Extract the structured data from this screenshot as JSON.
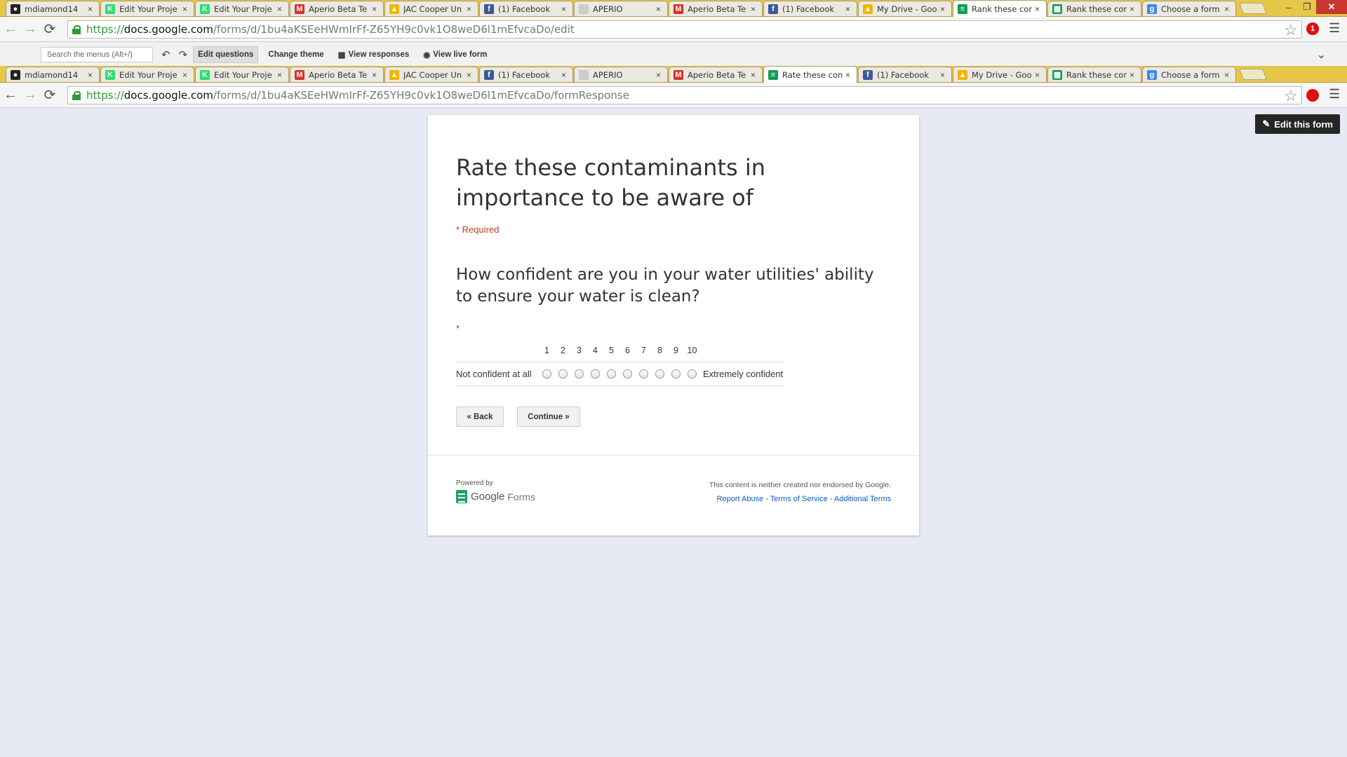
{
  "window": {
    "minimize": "–",
    "restore": "❐",
    "close": "✕"
  },
  "tabs_top": [
    {
      "title": "mdiamond14",
      "icon": "github-icon",
      "color": "#222222",
      "glyph": "●"
    },
    {
      "title": "Edit Your Proje",
      "icon": "kickstarter-icon",
      "color": "#2bde73",
      "glyph": "K"
    },
    {
      "title": "Edit Your Proje",
      "icon": "kickstarter-icon",
      "color": "#2bde73",
      "glyph": "K"
    },
    {
      "title": "Aperio Beta Te",
      "icon": "gmail-icon",
      "color": "#d93025",
      "glyph": "M"
    },
    {
      "title": "JAC Cooper Un",
      "icon": "drive-icon",
      "color": "#f4b400",
      "glyph": "▲"
    },
    {
      "title": "(1) Facebook",
      "icon": "facebook-icon",
      "color": "#3b5998",
      "glyph": "f"
    },
    {
      "title": "APERIO",
      "icon": "document-icon",
      "color": "#cccccc",
      "glyph": ""
    },
    {
      "title": "Aperio Beta Te",
      "icon": "gmail-icon",
      "color": "#d93025",
      "glyph": "M"
    },
    {
      "title": "(1) Facebook",
      "icon": "facebook-icon",
      "color": "#3b5998",
      "glyph": "f"
    },
    {
      "title": "My Drive - Goo",
      "icon": "drive-icon",
      "color": "#f4b400",
      "glyph": "▲"
    },
    {
      "title": "Rank these con",
      "icon": "forms-icon",
      "color": "#0f9d58",
      "glyph": "≡",
      "active": true
    },
    {
      "title": "Rank these con",
      "icon": "sheets-icon",
      "color": "#0f9d58",
      "glyph": "▦"
    },
    {
      "title": "Choose a form",
      "icon": "google-icon",
      "color": "#4285f4",
      "glyph": "g"
    }
  ],
  "tabs_inner": [
    {
      "title": "mdiamond14",
      "icon": "github-icon",
      "color": "#222222",
      "glyph": "●"
    },
    {
      "title": "Edit Your Proje",
      "icon": "kickstarter-icon",
      "color": "#2bde73",
      "glyph": "K"
    },
    {
      "title": "Edit Your Proje",
      "icon": "kickstarter-icon",
      "color": "#2bde73",
      "glyph": "K"
    },
    {
      "title": "Aperio Beta Te",
      "icon": "gmail-icon",
      "color": "#d93025",
      "glyph": "M"
    },
    {
      "title": "JAC Cooper Un",
      "icon": "drive-icon",
      "color": "#f4b400",
      "glyph": "▲"
    },
    {
      "title": "(1) Facebook",
      "icon": "facebook-icon",
      "color": "#3b5998",
      "glyph": "f"
    },
    {
      "title": "APERIO",
      "icon": "document-icon",
      "color": "#cccccc",
      "glyph": ""
    },
    {
      "title": "Aperio Beta Te",
      "icon": "gmail-icon",
      "color": "#d93025",
      "glyph": "M"
    },
    {
      "title": "Rate these cont",
      "icon": "forms-icon",
      "color": "#0f9d58",
      "glyph": "≡",
      "active": true
    },
    {
      "title": "(1) Facebook",
      "icon": "facebook-icon",
      "color": "#3b5998",
      "glyph": "f"
    },
    {
      "title": "My Drive - Goo",
      "icon": "drive-icon",
      "color": "#f4b400",
      "glyph": "▲"
    },
    {
      "title": "Rank these con",
      "icon": "sheets-icon",
      "color": "#0f9d58",
      "glyph": "▦"
    },
    {
      "title": "Choose a form",
      "icon": "google-icon",
      "color": "#4285f4",
      "glyph": "g"
    }
  ],
  "url_top": {
    "scheme": "https://",
    "host": "docs.google.com",
    "path": "/forms/d/1bu4aKSEeHWmIrFf-Z65YH9c0vk1O8weD6l1mEfvcaDo/edit"
  },
  "url_inner": {
    "scheme": "https://",
    "host": "docs.google.com",
    "path": "/forms/d/1bu4aKSEeHWmIrFf-Z65YH9c0vk1O8weD6l1mEfvcaDo/formResponse"
  },
  "ext_badge": "1",
  "toolbar": {
    "search_placeholder": "Search the menus (Alt+/)",
    "edit_questions": "Edit questions",
    "change_theme": "Change theme",
    "view_responses": "View responses",
    "view_live_form": "View live form"
  },
  "edit_form_button": "Edit this form",
  "form": {
    "title": "Rate these contaminants in importance to be aware of",
    "required_note": "* Required",
    "question": "How confident are you in your water utilities' ability to ensure your water is clean?",
    "question_required": "*",
    "scale_numbers": [
      "1",
      "2",
      "3",
      "4",
      "5",
      "6",
      "7",
      "8",
      "9",
      "10"
    ],
    "low_label": "Not confident at all",
    "high_label": "Extremely confident",
    "back_label": "« Back",
    "continue_label": "Continue »"
  },
  "footer": {
    "powered_by": "Powered by",
    "logo_google": "Google",
    "logo_forms": "Forms",
    "disclaimer": "This content is neither created nor endorsed by Google.",
    "report_abuse": "Report Abuse",
    "sep1": " - ",
    "terms": "Terms of Service",
    "sep2": " - ",
    "additional": "Additional Terms"
  }
}
